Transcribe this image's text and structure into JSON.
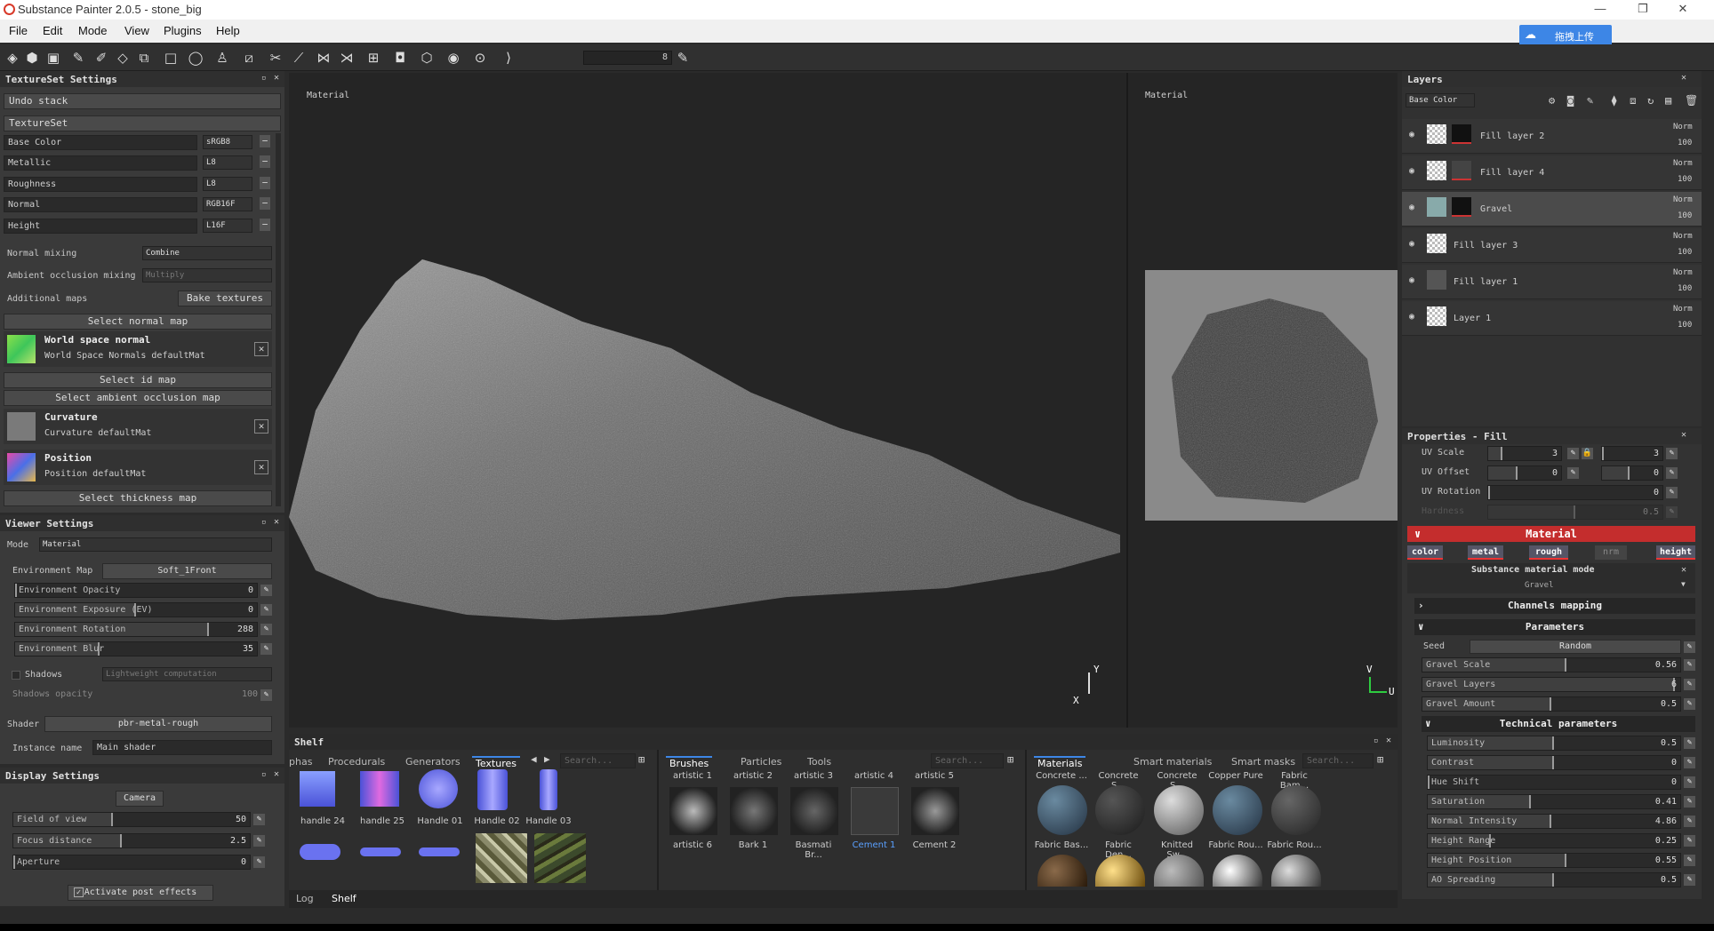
{
  "window": {
    "title": "Substance Painter 2.0.5 - stone_big",
    "controls": [
      "—",
      "❐",
      "✕"
    ]
  },
  "menu": [
    "File",
    "Edit",
    "Mode",
    "View",
    "Plugins",
    "Help"
  ],
  "upload_button": "拖拽上传",
  "toolbar": {
    "value": "8"
  },
  "textureset": {
    "header": "TextureSet Settings",
    "undo": "Undo stack",
    "textureset": "TextureSet",
    "channels": [
      {
        "name": "Base Color",
        "format": "sRGB8"
      },
      {
        "name": "Metallic",
        "format": "L8"
      },
      {
        "name": "Roughness",
        "format": "L8"
      },
      {
        "name": "Normal",
        "format": "RGB16F"
      },
      {
        "name": "Height",
        "format": "L16F"
      }
    ],
    "normal_mixing_label": "Normal mixing",
    "normal_mixing_value": "Combine",
    "ao_mixing_label": "Ambient occlusion mixing",
    "ao_mixing_value": "Multiply",
    "additional_maps": "Additional maps",
    "bake": "Bake textures",
    "select_normal": "Select normal map",
    "wsn_title": "World space normal",
    "wsn_sub": "World Space Normals defaultMat",
    "select_id": "Select id map",
    "select_ao": "Select ambient occlusion map",
    "curv_title": "Curvature",
    "curv_sub": "Curvature defaultMat",
    "pos_title": "Position",
    "pos_sub": "Position defaultMat",
    "select_thick": "Select thickness map"
  },
  "viewer": {
    "header": "Viewer Settings",
    "mode_label": "Mode",
    "mode_value": "Material",
    "env_map_label": "Environment Map",
    "env_map_value": "Soft_1Front",
    "sliders": [
      {
        "label": "Environment Opacity",
        "value": "0",
        "fill": 0
      },
      {
        "label": "Environment Exposure (EV)",
        "value": "0",
        "fill": 0.5
      },
      {
        "label": "Environment Rotation",
        "value": "288",
        "fill": 0.8
      },
      {
        "label": "Environment Blur",
        "value": "35",
        "fill": 0.35
      }
    ],
    "shadows_label": "Shadows",
    "shadows_value": "Lightweight computation",
    "shadows_opacity_label": "Shadows opacity",
    "shadows_opacity_value": "100",
    "shader_label": "Shader",
    "shader_value": "pbr-metal-rough",
    "instance_label": "Instance name",
    "instance_value": "Main shader"
  },
  "display": {
    "header": "Display Settings",
    "camera": "Camera",
    "sliders": [
      {
        "label": "Field of view",
        "value": "50",
        "fill": 0.42
      },
      {
        "label": "Focus distance",
        "value": "2.5",
        "fill": 0.46
      },
      {
        "label": "Aperture",
        "value": "0",
        "fill": 0
      }
    ],
    "post_effects": "Activate post effects"
  },
  "viewport": {
    "left_label": "Material",
    "right_label": "Material",
    "axis_y": "Y",
    "axis_x": "X",
    "axis_u": "U",
    "axis_v": "V"
  },
  "layers": {
    "header": "Layers",
    "channel": "Base Color",
    "items": [
      {
        "name": "Fill layer 2",
        "blend": "Norm",
        "opacity": "100"
      },
      {
        "name": "Fill layer 4",
        "blend": "Norm",
        "opacity": "100"
      },
      {
        "name": "Gravel",
        "blend": "Norm",
        "opacity": "100"
      },
      {
        "name": "Fill layer 3",
        "blend": "Norm",
        "opacity": "100"
      },
      {
        "name": "Fill layer 1",
        "blend": "Norm",
        "opacity": "100"
      },
      {
        "name": "Layer 1",
        "blend": "Norm",
        "opacity": "100"
      }
    ]
  },
  "properties": {
    "header": "Properties - Fill",
    "uv_scale": {
      "label": "UV Scale",
      "v1": "3",
      "v2": "3"
    },
    "uv_offset": {
      "label": "UV Offset",
      "v1": "0",
      "v2": "0"
    },
    "uv_rotation": {
      "label": "UV Rotation",
      "value": "0"
    },
    "hardness": {
      "label": "Hardness",
      "value": "0.5"
    },
    "material_header": "Material",
    "chips": [
      "color",
      "metal",
      "rough",
      "nrm",
      "height"
    ],
    "mode_label": "Substance material mode",
    "mode_value": "Gravel",
    "channels_mapping": "Channels mapping",
    "parameters": "Parameters",
    "seed_label": "Seed",
    "seed_value": "Random",
    "params": [
      {
        "label": "Gravel Scale",
        "value": "0.56",
        "fill": 0.56
      },
      {
        "label": "Gravel Layers",
        "value": "6",
        "fill": 0.98
      },
      {
        "label": "Gravel Amount",
        "value": "0.5",
        "fill": 0.5
      }
    ],
    "technical": "Technical parameters",
    "tech_params": [
      {
        "label": "Luminosity",
        "value": "0.5",
        "fill": 0.5
      },
      {
        "label": "Contrast",
        "value": "0",
        "fill": 0.5
      },
      {
        "label": "Hue Shift",
        "value": "0",
        "fill": 0
      },
      {
        "label": "Saturation",
        "value": "0.41",
        "fill": 0.41
      },
      {
        "label": "Normal Intensity",
        "value": "4.86",
        "fill": 0.49
      },
      {
        "label": "Height Range",
        "value": "0.25",
        "fill": 0.25
      },
      {
        "label": "Height Position",
        "value": "0.55",
        "fill": 0.55
      },
      {
        "label": "AO Spreading",
        "value": "0.5",
        "fill": 0.5
      }
    ]
  },
  "shelf": {
    "header": "Shelf",
    "tabs1": [
      "phas",
      "Procedurals",
      "Generators",
      "Textures"
    ],
    "tabs2": [
      "Brushes",
      "Particles",
      "Tools"
    ],
    "tabs3": [
      "Materials",
      "Smart materials",
      "Smart masks"
    ],
    "search": "Search...",
    "textures": [
      "handle 24",
      "handle 25",
      "Handle 01",
      "Handle 02",
      "Handle 03"
    ],
    "brushes_top": [
      "artistic 1",
      "artistic 2",
      "artistic 3",
      "artistic 4",
      "artistic 5"
    ],
    "brushes_bottom": [
      "artistic 6",
      "Bark 1",
      "Basmati Br...",
      "Cement 1",
      "Cement 2"
    ],
    "materials_top": [
      "Concrete ...",
      "Concrete S...",
      "Concrete S...",
      "Copper Pure",
      "Fabric Bam..."
    ],
    "materials_mid": [
      "Fabric Bas...",
      "Fabric Den...",
      "Knitted Sw...",
      "Fabric Rou...",
      "Fabric Rou..."
    ],
    "bottom_tabs": [
      "Log",
      "Shelf"
    ]
  },
  "colors": {
    "accent": "#c42d2d",
    "blue_tab": "#3d86e6"
  }
}
